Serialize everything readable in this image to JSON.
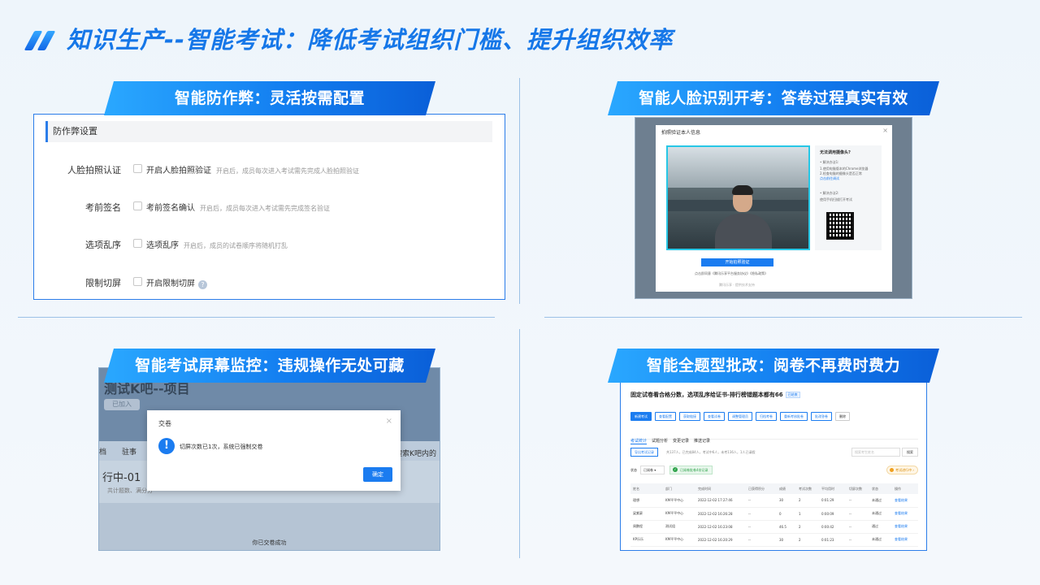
{
  "header": {
    "title": "知识生产--智能考试：降低考试组织门槛、提升组织效率"
  },
  "colors": {
    "accent": "#1677e8",
    "banner_start": "#2aa8ff",
    "banner_end": "#0a5fd8",
    "success": "#2ea34a",
    "warning": "#f0a020"
  },
  "icons": [
    "slash-logo-icon",
    "question-icon",
    "close-icon",
    "warning-icon",
    "check-icon",
    "clock-icon",
    "qr-code-icon"
  ],
  "panel1": {
    "banner": "智能防作弊：灵活按需配置",
    "section_title": "防作弊设置",
    "rows": [
      {
        "label": "人脸拍照认证",
        "option": "开启人脸拍照验证",
        "desc": "开启后，成员每次进入考试需先完成人脸拍照验证"
      },
      {
        "label": "考前签名",
        "option": "考前签名确认",
        "desc": "开启后，成员每次进入考试需先完成签名验证"
      },
      {
        "label": "选项乱序",
        "option": "选项乱序",
        "desc": "开启后，成员的试卷顺序将随机打乱"
      },
      {
        "label": "限制切屏",
        "option": "开启限制切屏",
        "desc": ""
      }
    ],
    "help_glyph": "?"
  },
  "panel2": {
    "banner": "智能人脸识别开考：答卷过程真实有效",
    "dialog_title": "拍照验证本人信息",
    "close_glyph": "×",
    "side_title": "无法调用摄像头?",
    "side_lines": [
      "• 解决办法1:",
      "1.使用电脑版本的Chrome浏览器",
      "2.检查电脑的摄像头是否正常",
      "点击前往调试",
      "• 解决办法2:",
      "使用手机扫描打开考试"
    ],
    "start_button": "开始拍照验证",
    "agreement": "点击即同意《腾讯乐享平台服务协议》《隐私政策》",
    "footer": "腾讯乐享 · 提供技术支持"
  },
  "panel3": {
    "banner": "智能考试屏幕监控：违规操作无处可藏",
    "bg_title": "测试K吧--项目",
    "bg_tag": "已加入",
    "bg_tabs": [
      "档",
      "驻事"
    ],
    "bg_item_title": "行中-01",
    "bg_item_sub": "共计题数、满分分",
    "bg_search": "搜索K吧内的",
    "bg_bottom": "你已交卷成功",
    "dialog_title": "交卷",
    "dialog_close": "×",
    "warn_glyph": "!",
    "message": "切屏次数已1次，系统已强制交卷",
    "ok_button": "确定"
  },
  "panel4": {
    "banner": "智能全题型批改：阅卷不再费时费力",
    "title": "固定试卷看合格分数，选项乱序给证书-排行榜错题本都有66",
    "title_tag": "已结束",
    "buttons": [
      "新建考试",
      "查看配置",
      "获取链接",
      "查看试卷",
      "调整管理员",
      "归档考卷",
      "重新考核批卷",
      "批改答卷",
      "删除"
    ],
    "tabs": [
      "考试统计",
      "试题分析",
      "变更记录",
      "推送记录"
    ],
    "export_button": "导出考试记录",
    "stats": "共137人，已完成84人，考试中6人，未考136人，1人已请假",
    "search_placeholder": "搜索考生姓名",
    "search_button": "搜索",
    "status_label": "状态",
    "status_value": "已阅卷 ▾",
    "graded_badge": "已阅卷批卷4份记录",
    "pending_badge": "考试进行中 ›",
    "columns": [
      "姓名",
      "部门",
      "完成时间",
      "已获得积分",
      "成绩",
      "考试次数",
      "平均用时",
      "切屏次数",
      "状态",
      "操作"
    ],
    "rows": [
      [
        "理想",
        "KM平平中心",
        "2022-12-02 17:27:46",
        "--",
        "30",
        "2",
        "0:01:29",
        "--",
        "未通过",
        "查看结果"
      ],
      [
        "梁紫豪",
        "KM平平中心",
        "2022-12-02 16:26:28",
        "--",
        "0",
        "1",
        "0:00:09",
        "--",
        "未通过",
        "查看结果"
      ],
      [
        "周鹏程",
        "测试组",
        "2022-12-02 16:23:08",
        "--",
        "46.5",
        "2",
        "0:00:42",
        "--",
        "通过",
        "查看结果"
      ],
      [
        "KP乐乐",
        "KM平平中心",
        "2022-12-02 16:20:29",
        "--",
        "30",
        "2",
        "0:01:23",
        "--",
        "未通过",
        "查看结果"
      ]
    ]
  }
}
